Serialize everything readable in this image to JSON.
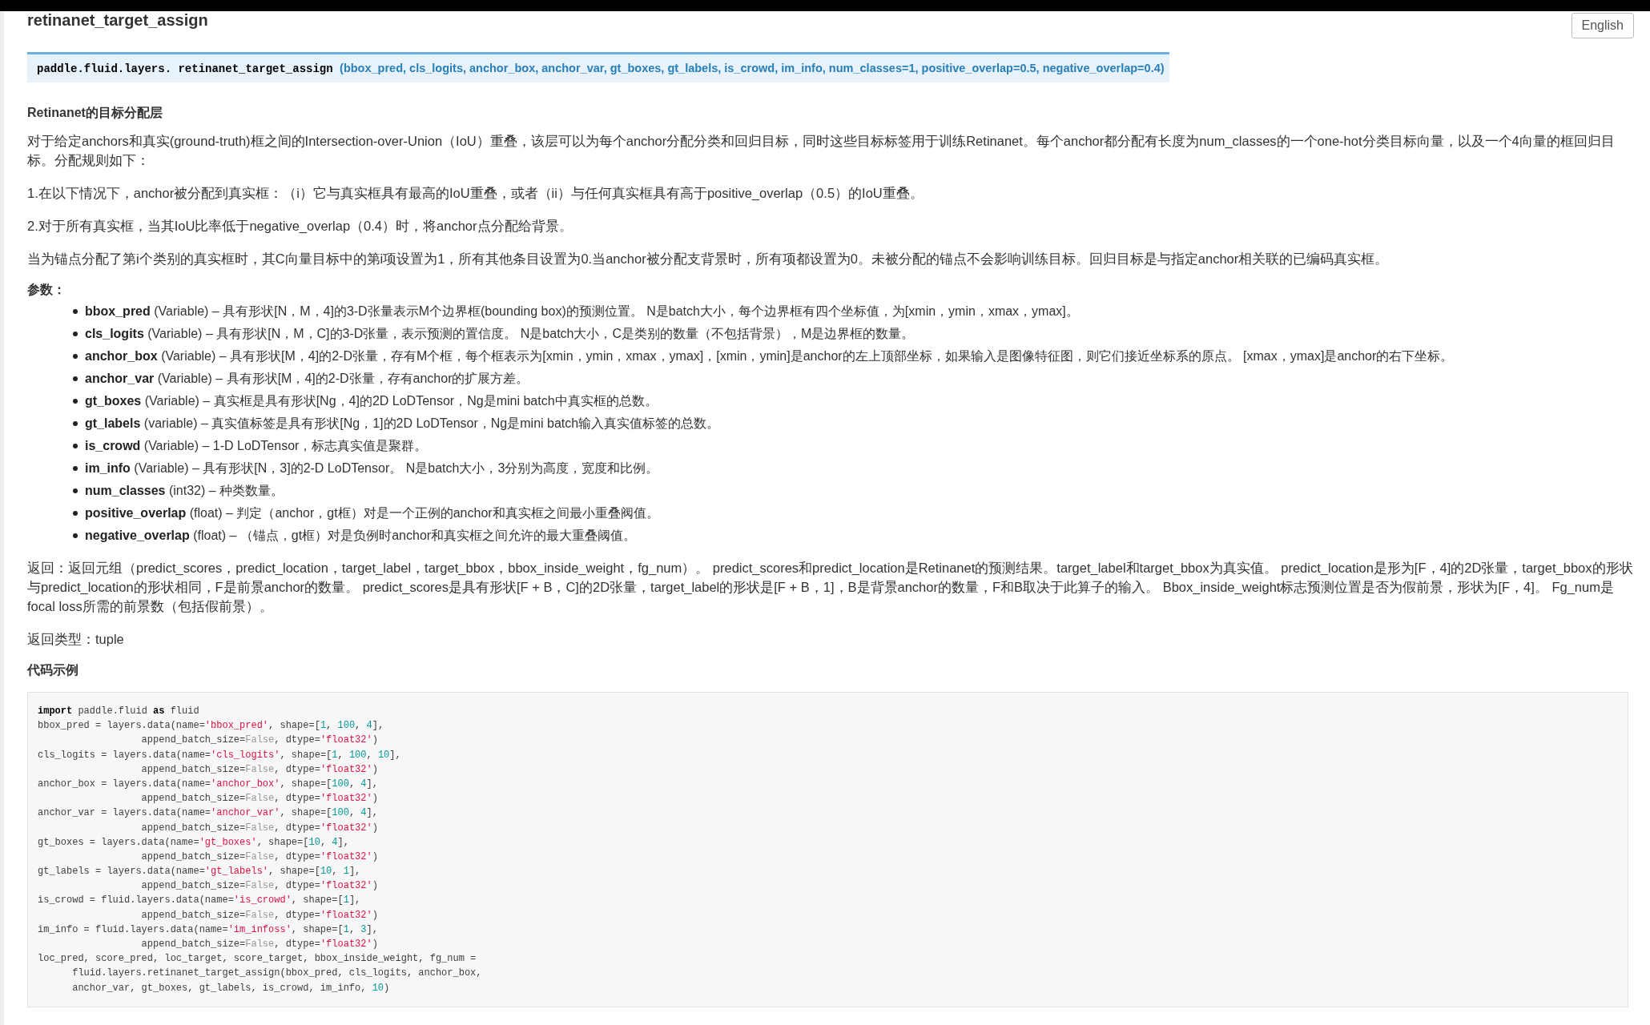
{
  "page_title": "retinanet_target_assign",
  "language_button": "English",
  "signature": {
    "prefix": "paddle.fluid.layers.",
    "name": "retinanet_target_assign",
    "params": "(bbox_pred, cls_logits, anchor_box, anchor_var, gt_boxes, gt_labels, is_crowd, im_info, num_classes=1, positive_overlap=0.5, negative_overlap=0.4)"
  },
  "subtitle": "Retinanet的目标分配层",
  "paragraphs": [
    "对于给定anchors和真实(ground-truth)框之间的Intersection-over-Union（IoU）重叠，该层可以为每个anchor分配分类和回归目标，同时这些目标标签用于训练Retinanet。每个anchor都分配有长度为num_classes的一个one-hot分类目标向量，以及一个4向量的框回归目标。分配规则如下：",
    "1.在以下情况下，anchor被分配到真实框：（i）它与真实框具有最高的IoU重叠，或者（ii）与任何真实框具有高于positive_overlap（0.5）的IoU重叠。",
    "2.对于所有真实框，当其IoU比率低于negative_overlap（0.4）时，将anchor点分配给背景。",
    "当为锚点分配了第i个类别的真实框时，其C向量目标中的第i项设置为1，所有其他条目设置为0.当anchor被分配支背景时，所有项都设置为0。未被分配的锚点不会影响训练目标。回归目标是与指定anchor相关联的已编码真实框。"
  ],
  "params_label": "参数：",
  "params": [
    "**bbox_pred** (Variable) – 具有形状[N，M，4]的3-D张量表示M个边界框(bounding box)的预测位置。 N是batch大小，每个边界框有四个坐标值，为[xmin，ymin，xmax，ymax]。",
    "**cls_logits** (Variable) – 具有形状[N，M，C]的3-D张量，表示预测的置信度。 N是batch大小，C是类别的数量（不包括背景），M是边界框的数量。",
    "**anchor_box** (Variable) – 具有形状[M，4]的2-D张量，存有M个框，每个框表示为[xmin，ymin，xmax，ymax]，[xmin，ymin]是anchor的左上顶部坐标，如果输入是图像特征图，则它们接近坐标系的原点。 [xmax，ymax]是anchor的右下坐标。",
    "**anchor_var** (Variable) – 具有形状[M，4]的2-D张量，存有anchor的扩展方差。",
    "**gt_boxes** (Variable) – 真实框是具有形状[Ng，4]的2D LoDTensor，Ng是mini batch中真实框的总数。",
    "**gt_labels** (variable) – 真实值标签是具有形状[Ng，1]的2D LoDTensor，Ng是mini batch输入真实值标签的总数。",
    "**is_crowd** (Variable) – 1-D LoDTensor，标志真实值是聚群。",
    "**im_info** (Variable) – 具有形状[N，3]的2-D LoDTensor。 N是batch大小，3分别为高度，宽度和比例。",
    "**num_classes** (int32) – 种类数量。",
    "**positive_overlap** (float) – 判定（anchor，gt框）对是一个正例的anchor和真实框之间最小重叠阀值。",
    "**negative_overlap** (float) – （锚点，gt框）对是负例时anchor和真实框之间允许的最大重叠阈值。"
  ],
  "returns": "返回：返回元组（predict_scores，predict_location，target_label，target_bbox，bbox_inside_weight，fg_num）。 predict_scores和predict_location是Retinanet的预测结果。target_label和target_bbox为真实值。 predict_location是形为[F，4]的2D张量，target_bbox的形状与predict_location的形状相同，F是前景anchor的数量。 predict_scores是具有形状[F + B，C]的2D张量，target_label的形状是[F + B，1]，B是背景anchor的数量，F和B取决于此算子的输入。 Bbox_inside_weight标志预测位置是否为假前景，形状为[F，4]。 Fg_num是focal loss所需的前景数（包括假前景）。",
  "return_type": "返回类型：tuple",
  "example_heading": "代码示例",
  "code_lines": [
    [
      {
        "kind": "kw",
        "text": "import"
      },
      {
        "kind": "p",
        "text": " paddle.fluid "
      },
      {
        "kind": "kw",
        "text": "as"
      },
      {
        "kind": "p",
        "text": " fluid"
      }
    ],
    [
      {
        "kind": "p",
        "text": "bbox_pred = layers.data(name="
      },
      {
        "kind": "str",
        "text": "'bbox_pred'"
      },
      {
        "kind": "p",
        "text": ", shape=["
      },
      {
        "kind": "num",
        "text": "1"
      },
      {
        "kind": "p",
        "text": ", "
      },
      {
        "kind": "num",
        "text": "100"
      },
      {
        "kind": "p",
        "text": ", "
      },
      {
        "kind": "num",
        "text": "4"
      },
      {
        "kind": "p",
        "text": "],"
      }
    ],
    [
      {
        "kind": "p",
        "text": "                  append_batch_size="
      },
      {
        "kind": "const",
        "text": "False"
      },
      {
        "kind": "p",
        "text": ", dtype="
      },
      {
        "kind": "str",
        "text": "'float32'"
      },
      {
        "kind": "p",
        "text": ")"
      }
    ],
    [
      {
        "kind": "p",
        "text": "cls_logits = layers.data(name="
      },
      {
        "kind": "str",
        "text": "'cls_logits'"
      },
      {
        "kind": "p",
        "text": ", shape=["
      },
      {
        "kind": "num",
        "text": "1"
      },
      {
        "kind": "p",
        "text": ", "
      },
      {
        "kind": "num",
        "text": "100"
      },
      {
        "kind": "p",
        "text": ", "
      },
      {
        "kind": "num",
        "text": "10"
      },
      {
        "kind": "p",
        "text": "],"
      }
    ],
    [
      {
        "kind": "p",
        "text": "                  append_batch_size="
      },
      {
        "kind": "const",
        "text": "False"
      },
      {
        "kind": "p",
        "text": ", dtype="
      },
      {
        "kind": "str",
        "text": "'float32'"
      },
      {
        "kind": "p",
        "text": ")"
      }
    ],
    [
      {
        "kind": "p",
        "text": "anchor_box = layers.data(name="
      },
      {
        "kind": "str",
        "text": "'anchor_box'"
      },
      {
        "kind": "p",
        "text": ", shape=["
      },
      {
        "kind": "num",
        "text": "100"
      },
      {
        "kind": "p",
        "text": ", "
      },
      {
        "kind": "num",
        "text": "4"
      },
      {
        "kind": "p",
        "text": "],"
      }
    ],
    [
      {
        "kind": "p",
        "text": "                  append_batch_size="
      },
      {
        "kind": "const",
        "text": "False"
      },
      {
        "kind": "p",
        "text": ", dtype="
      },
      {
        "kind": "str",
        "text": "'float32'"
      },
      {
        "kind": "p",
        "text": ")"
      }
    ],
    [
      {
        "kind": "p",
        "text": "anchor_var = layers.data(name="
      },
      {
        "kind": "str",
        "text": "'anchor_var'"
      },
      {
        "kind": "p",
        "text": ", shape=["
      },
      {
        "kind": "num",
        "text": "100"
      },
      {
        "kind": "p",
        "text": ", "
      },
      {
        "kind": "num",
        "text": "4"
      },
      {
        "kind": "p",
        "text": "],"
      }
    ],
    [
      {
        "kind": "p",
        "text": "                  append_batch_size="
      },
      {
        "kind": "const",
        "text": "False"
      },
      {
        "kind": "p",
        "text": ", dtype="
      },
      {
        "kind": "str",
        "text": "'float32'"
      },
      {
        "kind": "p",
        "text": ")"
      }
    ],
    [
      {
        "kind": "p",
        "text": "gt_boxes = layers.data(name="
      },
      {
        "kind": "str",
        "text": "'gt_boxes'"
      },
      {
        "kind": "p",
        "text": ", shape=["
      },
      {
        "kind": "num",
        "text": "10"
      },
      {
        "kind": "p",
        "text": ", "
      },
      {
        "kind": "num",
        "text": "4"
      },
      {
        "kind": "p",
        "text": "],"
      }
    ],
    [
      {
        "kind": "p",
        "text": "                  append_batch_size="
      },
      {
        "kind": "const",
        "text": "False"
      },
      {
        "kind": "p",
        "text": ", dtype="
      },
      {
        "kind": "str",
        "text": "'float32'"
      },
      {
        "kind": "p",
        "text": ")"
      }
    ],
    [
      {
        "kind": "p",
        "text": "gt_labels = layers.data(name="
      },
      {
        "kind": "str",
        "text": "'gt_labels'"
      },
      {
        "kind": "p",
        "text": ", shape=["
      },
      {
        "kind": "num",
        "text": "10"
      },
      {
        "kind": "p",
        "text": ", "
      },
      {
        "kind": "num",
        "text": "1"
      },
      {
        "kind": "p",
        "text": "],"
      }
    ],
    [
      {
        "kind": "p",
        "text": "                  append_batch_size="
      },
      {
        "kind": "const",
        "text": "False"
      },
      {
        "kind": "p",
        "text": ", dtype="
      },
      {
        "kind": "str",
        "text": "'float32'"
      },
      {
        "kind": "p",
        "text": ")"
      }
    ],
    [
      {
        "kind": "p",
        "text": "is_crowd = fluid.layers.data(name="
      },
      {
        "kind": "str",
        "text": "'is_crowd'"
      },
      {
        "kind": "p",
        "text": ", shape=["
      },
      {
        "kind": "num",
        "text": "1"
      },
      {
        "kind": "p",
        "text": "],"
      }
    ],
    [
      {
        "kind": "p",
        "text": "                  append_batch_size="
      },
      {
        "kind": "const",
        "text": "False"
      },
      {
        "kind": "p",
        "text": ", dtype="
      },
      {
        "kind": "str",
        "text": "'float32'"
      },
      {
        "kind": "p",
        "text": ")"
      }
    ],
    [
      {
        "kind": "p",
        "text": "im_info = fluid.layers.data(name="
      },
      {
        "kind": "str",
        "text": "'im_infoss'"
      },
      {
        "kind": "p",
        "text": ", shape=["
      },
      {
        "kind": "num",
        "text": "1"
      },
      {
        "kind": "p",
        "text": ", "
      },
      {
        "kind": "num",
        "text": "3"
      },
      {
        "kind": "p",
        "text": "],"
      }
    ],
    [
      {
        "kind": "p",
        "text": "                  append_batch_size="
      },
      {
        "kind": "const",
        "text": "False"
      },
      {
        "kind": "p",
        "text": ", dtype="
      },
      {
        "kind": "str",
        "text": "'float32'"
      },
      {
        "kind": "p",
        "text": ")"
      }
    ],
    [
      {
        "kind": "p",
        "text": "loc_pred, score_pred, loc_target, score_target, bbox_inside_weight, fg_num ="
      }
    ],
    [
      {
        "kind": "p",
        "text": "      fluid.layers.retinanet_target_assign(bbox_pred, cls_logits, anchor_box,"
      }
    ],
    [
      {
        "kind": "p",
        "text": "      anchor_var, gt_boxes, gt_labels, is_crowd, im_info, "
      },
      {
        "kind": "num",
        "text": "10"
      },
      {
        "kind": "p",
        "text": ")"
      }
    ]
  ]
}
